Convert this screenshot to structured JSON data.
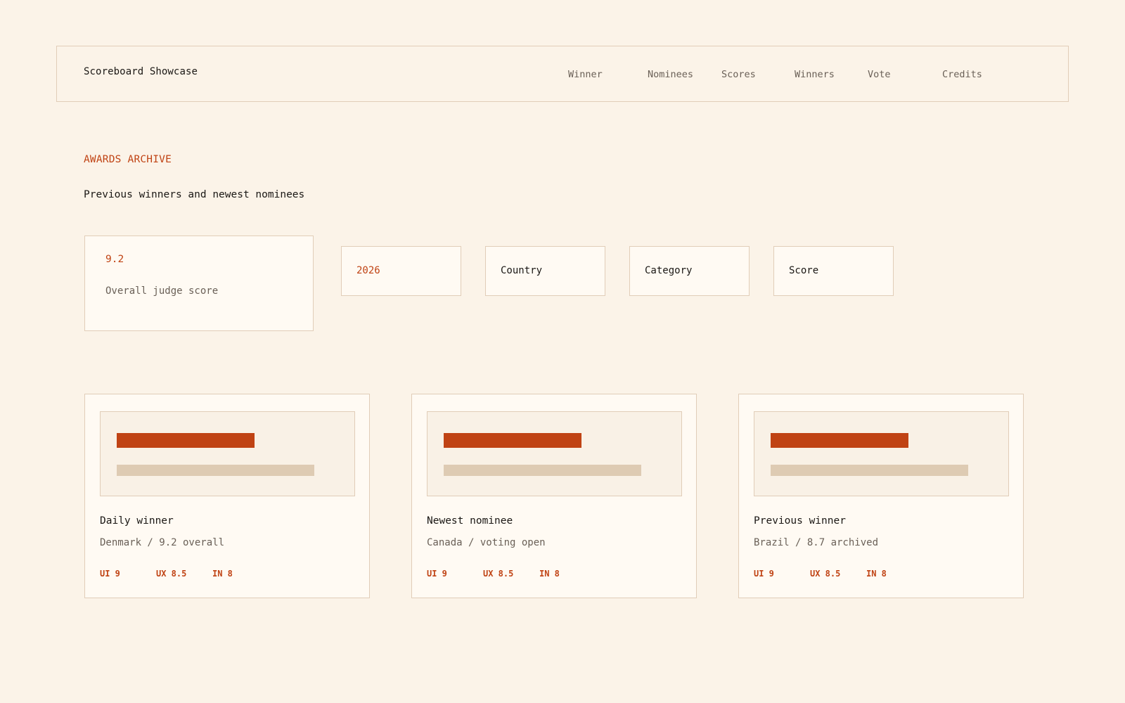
{
  "header": {
    "brand": "Scoreboard Showcase",
    "nav": [
      "Winner",
      "Nominees",
      "Scores",
      "Winners",
      "Vote",
      "Credits"
    ]
  },
  "hero": {
    "eyebrow": "AWARDS ARCHIVE",
    "title": "Previous winners and newest nominees"
  },
  "score_card": {
    "value": "9.2",
    "label": "Overall judge score"
  },
  "filters": [
    "2026",
    "Country",
    "Category",
    "Score"
  ],
  "cards": [
    {
      "title": "Daily winner",
      "subtitle": "Denmark / 9.2 overall",
      "metrics": [
        "UI 9",
        "UX 8.5",
        "IN 8"
      ]
    },
    {
      "title": "Newest nominee",
      "subtitle": "Canada / voting open",
      "metrics": [
        "UI 9",
        "UX 8.5",
        "IN 8"
      ]
    },
    {
      "title": "Previous winner",
      "subtitle": "Brazil / 8.7 archived",
      "metrics": [
        "UI 9",
        "UX 8.5",
        "IN 8"
      ]
    }
  ],
  "colors": {
    "background": "#fbf3e8",
    "card": "#fffaf3",
    "accent": "#c04314",
    "border": "#e1cdb8",
    "track": "#decbb3",
    "muted_text": "#6a6057"
  }
}
